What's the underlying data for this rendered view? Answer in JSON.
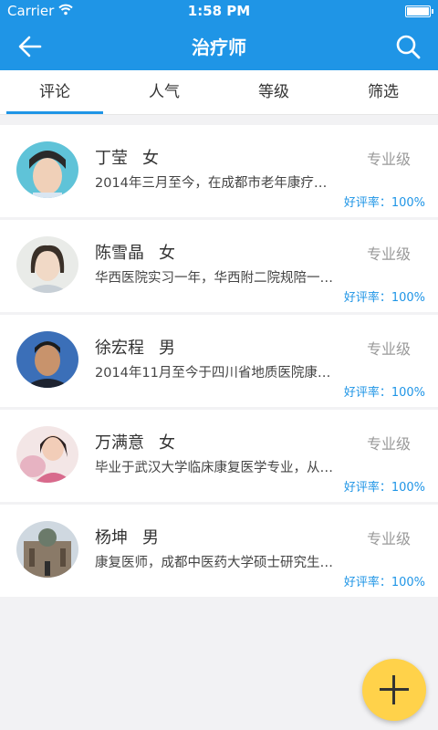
{
  "status": {
    "carrier": "Carrier",
    "time": "1:58 PM"
  },
  "nav": {
    "title": "治疗师"
  },
  "tabs": [
    "评论",
    "人气",
    "等级",
    "筛选"
  ],
  "therapists": [
    {
      "name": "丁莹",
      "gender": "女",
      "level": "专业级",
      "desc": "2014年三月至今，在成都市老年康疗…",
      "rating": "好评率：100%"
    },
    {
      "name": "陈雪晶",
      "gender": "女",
      "level": "专业级",
      "desc": "华西医院实习一年，华西附二院规陪一…",
      "rating": "好评率：100%"
    },
    {
      "name": "徐宏程",
      "gender": "男",
      "level": "专业级",
      "desc": "2014年11月至今于四川省地质医院康…",
      "rating": "好评率：100%"
    },
    {
      "name": "万满意",
      "gender": "女",
      "level": "专业级",
      "desc": "毕业于武汉大学临床康复医学专业，从…",
      "rating": "好评率：100%"
    },
    {
      "name": "杨坤",
      "gender": "男",
      "level": "专业级",
      "desc": "康复医师，成都中医药大学硕士研究生…",
      "rating": "好评率：100%"
    }
  ],
  "colors": {
    "primary": "#1f95e6",
    "fab": "#ffd24a"
  }
}
